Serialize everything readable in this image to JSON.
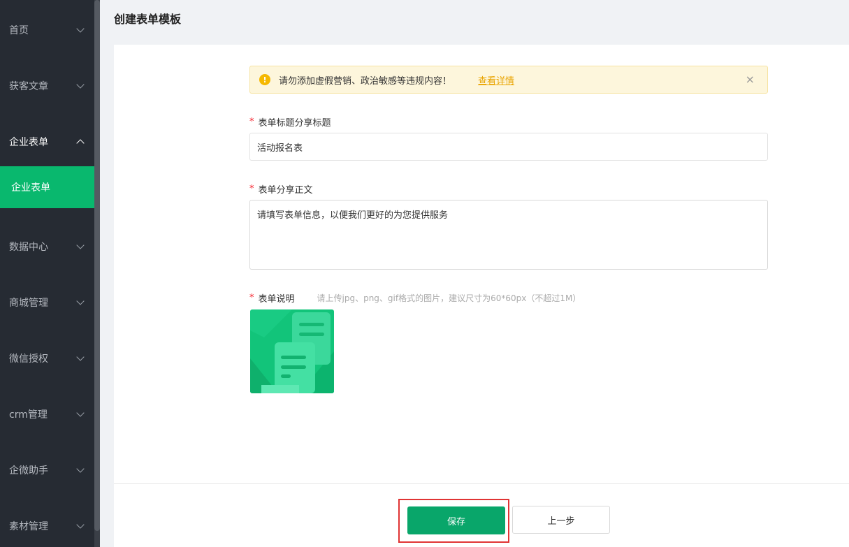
{
  "sidebar": {
    "items": [
      {
        "label": "首页"
      },
      {
        "label": "获客文章"
      },
      {
        "label": "企业表单"
      },
      {
        "label": "数据中心"
      },
      {
        "label": "商城管理"
      },
      {
        "label": "微信授权"
      },
      {
        "label": "crm管理"
      },
      {
        "label": "企微助手"
      },
      {
        "label": "素材管理"
      }
    ],
    "active_sub_item": "企业表单"
  },
  "page": {
    "title": "创建表单模板"
  },
  "alert": {
    "text": "请勿添加虚假营销、政治敏感等违规内容！",
    "link": "查看详情",
    "close": "×"
  },
  "form": {
    "title_field": {
      "required_mark": "*",
      "label": "表单标题分享标题",
      "value": "活动报名表"
    },
    "body_field": {
      "required_mark": "*",
      "label": "表单分享正文",
      "value": "请填写表单信息，以便我们更好的为您提供服务"
    },
    "desc_field": {
      "required_mark": "*",
      "label": "表单说明",
      "hint": "请上传jpg、png、gif格式的图片，建议尺寸为60*60px（不超过1M）"
    }
  },
  "footer": {
    "save_label": "保存",
    "prev_label": "上一步"
  },
  "colors": {
    "sidebar_bg": "#262b33",
    "accent": "#09b86e",
    "save_button": "#09a66a",
    "highlight_box": "#e03434",
    "alert_bg": "#fdf6dc"
  }
}
